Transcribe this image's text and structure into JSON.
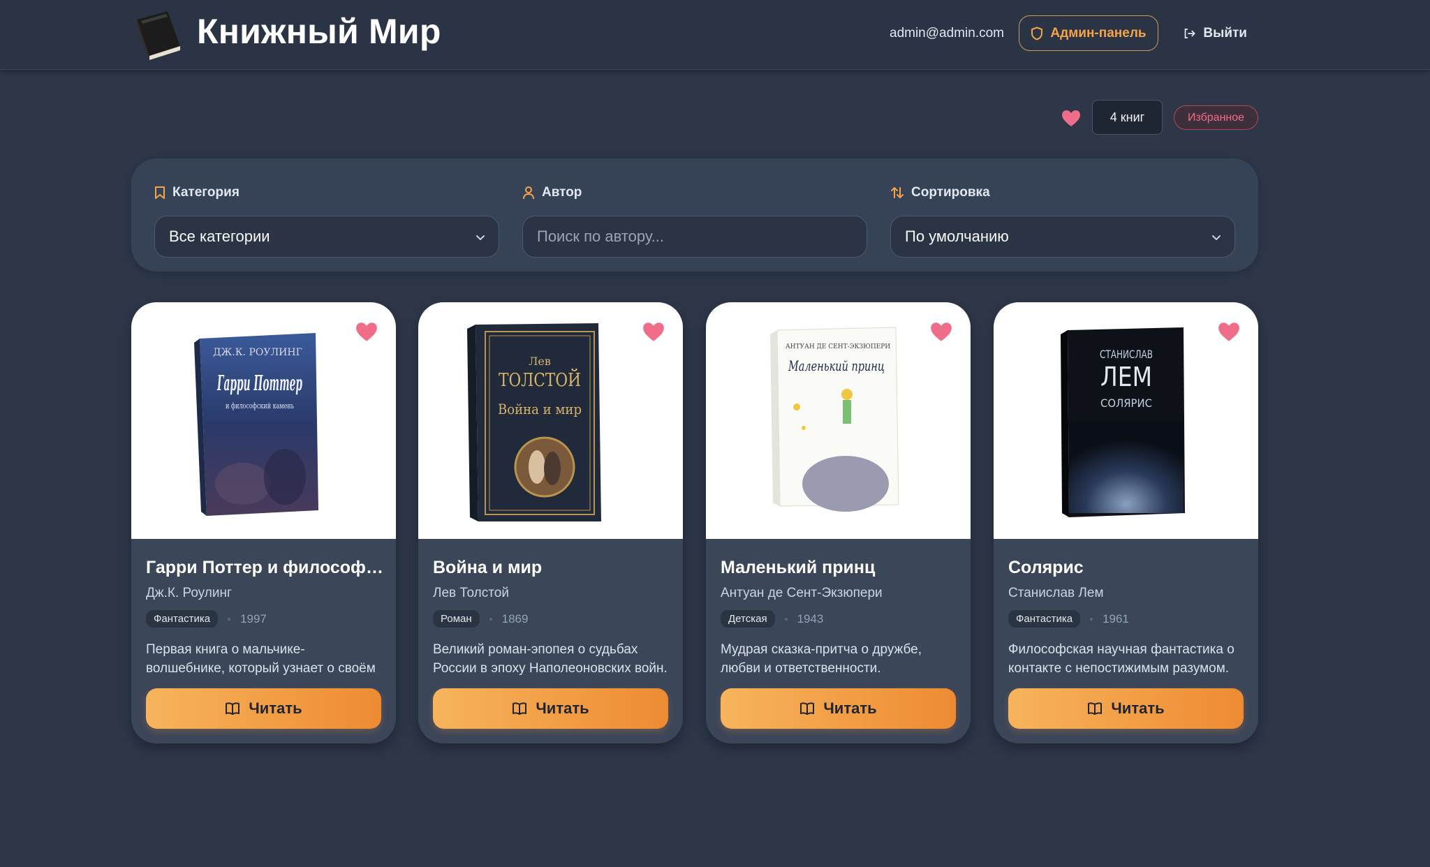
{
  "header": {
    "brand": "Книжный Мир",
    "email": "admin@admin.com",
    "admin_label": "Админ-панель",
    "logout_label": "Выйти"
  },
  "stats": {
    "count_label": "4 книг",
    "favorites_label": "Избранное"
  },
  "filters": {
    "category": {
      "label": "Категория",
      "value": "Все категории"
    },
    "author": {
      "label": "Автор",
      "placeholder": "Поиск по автору..."
    },
    "sort": {
      "label": "Сортировка",
      "value": "По умолчанию"
    }
  },
  "books": [
    {
      "title": "Гарри Поттер и философский камень",
      "author": "Дж.К. Роулинг",
      "category": "Фантастика",
      "year": "1997",
      "description": "Первая книга о мальчике-волшебнике, который узнает о своём",
      "read_label": "Читать",
      "cover_lines": [
        "ДЖ.К. РОУЛИНГ",
        "Гарри Поттер",
        "и философский камень"
      ]
    },
    {
      "title": "Война и мир",
      "author": "Лев Толстой",
      "category": "Роман",
      "year": "1869",
      "description": "Великий роман-эпопея о судьбах России в эпоху Наполеоновских войн.",
      "read_label": "Читать",
      "cover_lines": [
        "Лев",
        "ТОЛСТОЙ",
        "Война и мир"
      ]
    },
    {
      "title": "Маленький принц",
      "author": "Антуан де Сент-Экзюпери",
      "category": "Детская",
      "year": "1943",
      "description": "Мудрая сказка-притча о дружбе, любви и ответственности.",
      "read_label": "Читать",
      "cover_lines": [
        "АНТУАН ДЕ СЕНТ-ЭКЗЮПЕРИ",
        "Маленький принц"
      ]
    },
    {
      "title": "Солярис",
      "author": "Станислав Лем",
      "category": "Фантастика",
      "year": "1961",
      "description": "Философская научная фантастика о контакте с непостижимым разумом.",
      "read_label": "Читать",
      "cover_lines": [
        "СТАНИСЛАВ",
        "ЛЕМ",
        "СОЛЯРИС"
      ]
    }
  ],
  "colors": {
    "accent": "#f6a34a",
    "heart": "#f06d8a",
    "background": "#2d3748"
  }
}
